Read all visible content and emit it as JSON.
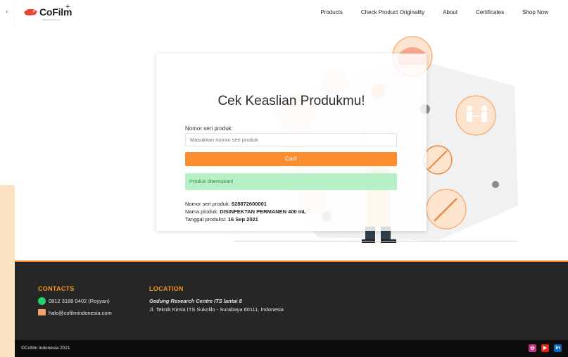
{
  "brand": {
    "name": "CoFilm",
    "plus": "+",
    "sub": "cofilmindonesia.com"
  },
  "nav": {
    "items": [
      {
        "label": "Products"
      },
      {
        "label": "Check Product Originality"
      },
      {
        "label": "About"
      },
      {
        "label": "Certificates"
      },
      {
        "label": "Shop Now"
      }
    ]
  },
  "card": {
    "title": "Cek Keaslian Produkmu!",
    "serial_label": "Nomor seri produk:",
    "serial_placeholder": "Masukkan nomor seri produk",
    "search_button": "Cari!",
    "alert": "Produk ditemukan!",
    "result": {
      "serial_label": "Nomor seri produk:",
      "serial_value": "628872600001",
      "name_label": "Nama produk:",
      "name_value": "DISINFEKTAN PERMANEN 400 mL",
      "date_label": "Tanggal produksi:",
      "date_value": "16 Sep 2021"
    }
  },
  "footer": {
    "contacts_title": "CONTACTS",
    "phone": "0812 3188 0402 (Royyan)",
    "email": "halo@cofilmindonesia.com",
    "location_title": "LOCATION",
    "location_name": "Gedung Research Centre ITS lantai 8",
    "location_address": "Jl. Teknik Kimia ITS Sukolilo - Surabaya 60111, Indonesia",
    "copyright": "©Cofilm Indonesia 2021"
  },
  "social": [
    "instagram-icon",
    "youtube-icon",
    "linkedin-icon"
  ],
  "colors": {
    "accent": "#f98d2f",
    "footer_bg": "#262626",
    "success_bg": "#b7f0c6"
  }
}
